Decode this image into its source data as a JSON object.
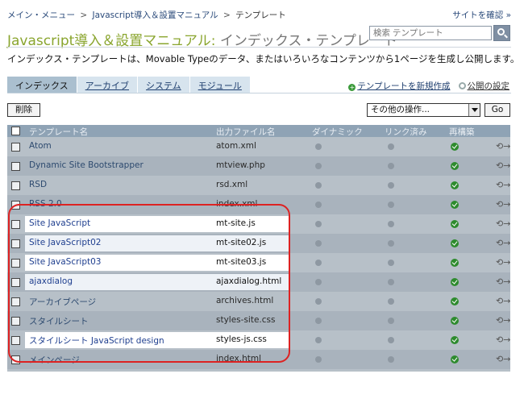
{
  "breadcrumb": {
    "items": [
      "メイン・メニュー",
      "Javascript導入＆設置マニュアル",
      "テンプレート"
    ],
    "separator": ">"
  },
  "site_confirm": "サイトを確認 »",
  "title": {
    "blog": "Javascript導入＆設置マニュアル",
    "sep": ": ",
    "sub": "インデックス・テンプレート"
  },
  "search": {
    "placeholder": "検索 テンプレート"
  },
  "description": "インデックス・テンプレートは、Movable Typeのデータ、またはいろいろなコンテンツから1ページを生成し公開します。",
  "tabs": [
    {
      "label": "インデックス",
      "active": true
    },
    {
      "label": "アーカイブ",
      "active": false
    },
    {
      "label": "システム",
      "active": false
    },
    {
      "label": "モジュール",
      "active": false
    }
  ],
  "links": {
    "new_template": "テンプレートを新規作成",
    "publish_settings": "公開の設定"
  },
  "toolbar": {
    "delete_label": "削除",
    "more_actions": "その他の操作...",
    "go_label": "Go"
  },
  "table": {
    "headers": {
      "name": "テンプレート名",
      "output": "出力ファイル名",
      "dynamic": "ダイナミック",
      "linked": "リンク済み",
      "rebuild": "再構築"
    },
    "rows": [
      {
        "name": "Atom",
        "output": "atom.xml",
        "highlighted": false
      },
      {
        "name": "Dynamic Site Bootstrapper",
        "output": "mtview.php",
        "highlighted": false
      },
      {
        "name": "RSD",
        "output": "rsd.xml",
        "highlighted": false
      },
      {
        "name": "RSS 2.0",
        "output": "index.xml",
        "highlighted": false
      },
      {
        "name": "Site JavaScript",
        "output": "mt-site.js",
        "highlighted": true
      },
      {
        "name": "Site JavaScript02",
        "output": "mt-site02.js",
        "highlighted": true
      },
      {
        "name": "Site JavaScript03",
        "output": "mt-site03.js",
        "highlighted": true
      },
      {
        "name": "ajaxdialog",
        "output": "ajaxdialog.html",
        "highlighted": true
      },
      {
        "name": "アーカイブページ",
        "output": "archives.html",
        "highlighted": false
      },
      {
        "name": "スタイルシート",
        "output": "styles-site.css",
        "highlighted": false
      },
      {
        "name": "スタイルシート JavaScript design",
        "output": "styles-js.css",
        "highlighted": true
      },
      {
        "name": "メインページ",
        "output": "index.html",
        "highlighted": false
      }
    ]
  },
  "icons": {
    "dynamic": "dynamic-off-icon",
    "linked": "linked-off-icon",
    "rebuild": "check-icon",
    "publish": "publish-icon"
  },
  "colors": {
    "accent_title": "#8aa52e",
    "header_bg": "#8fa3b5",
    "check_green": "#2e8b2e",
    "highlight_border": "#dd2222"
  }
}
